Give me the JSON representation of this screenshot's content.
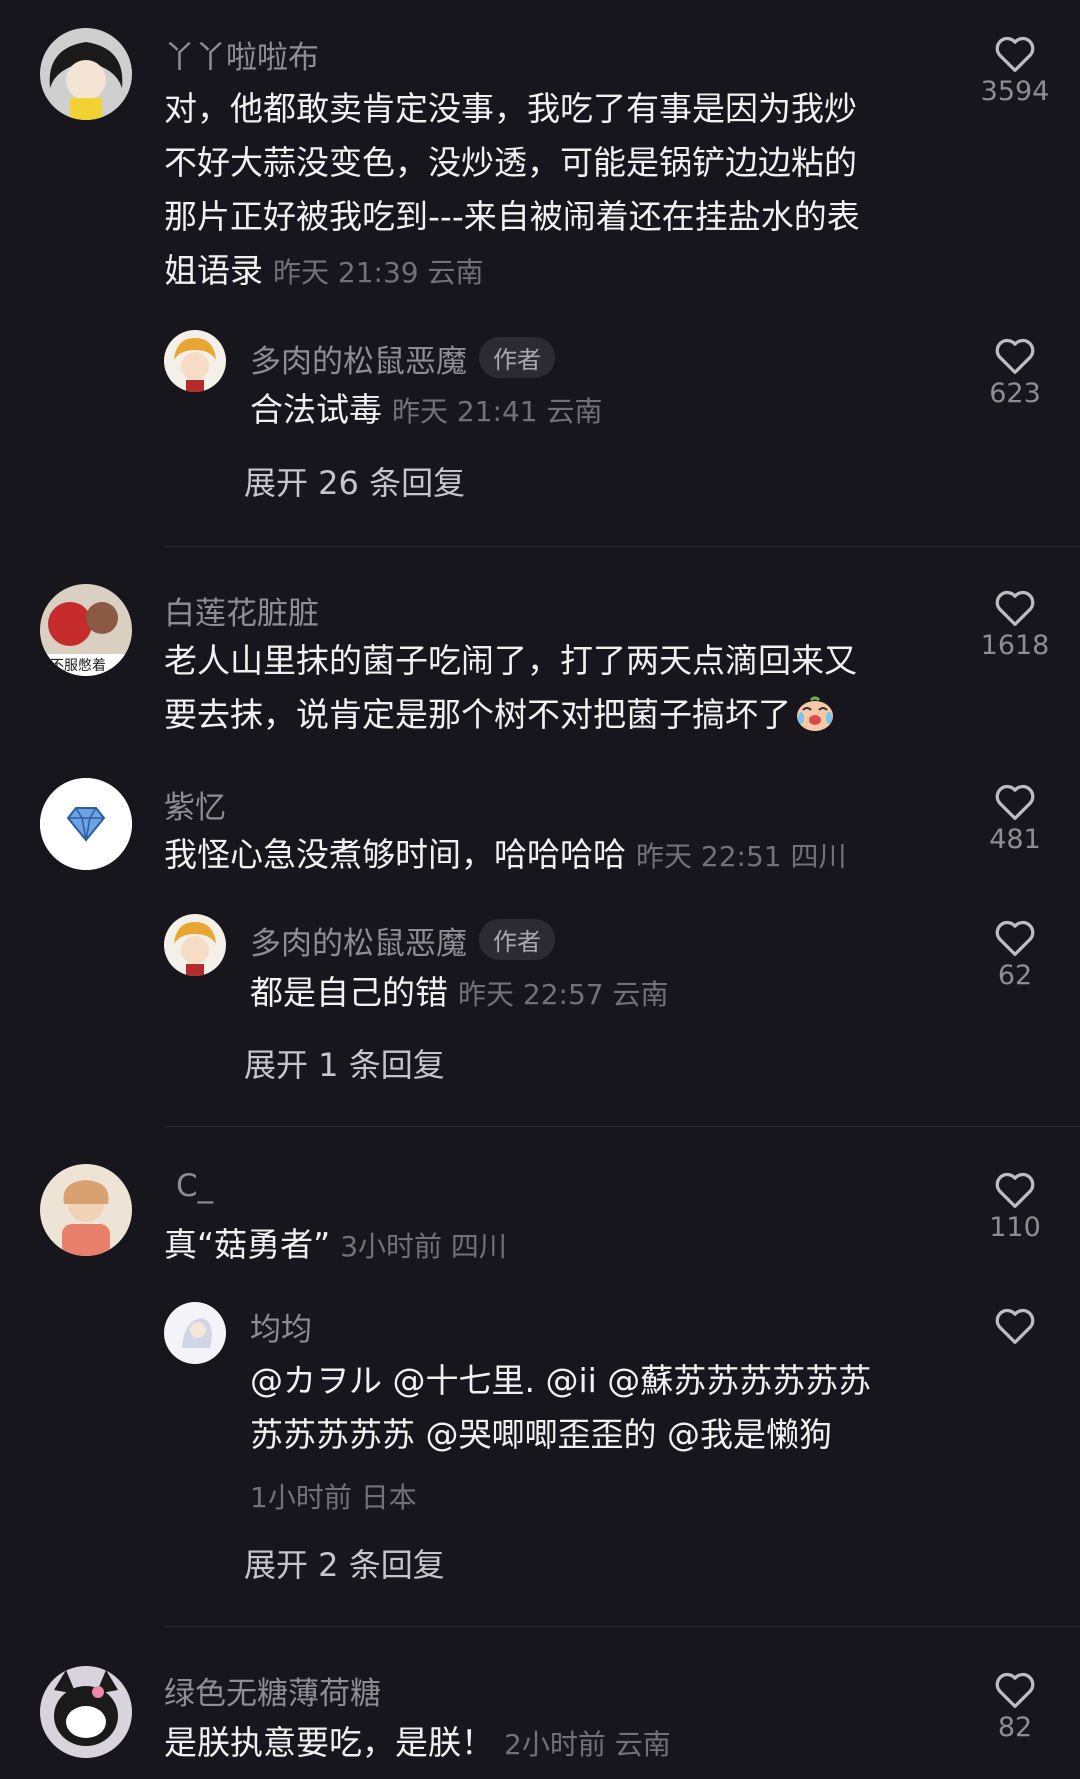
{
  "colors": {
    "background": "#17161c",
    "username": "#8e8d93",
    "text": "#f1f1f1",
    "meta": "#727176",
    "expand": "#c6c5ca"
  },
  "icons": {
    "like": "heart-outline-icon"
  },
  "comments": [
    {
      "username": "丫丫啦啦布",
      "lines": [
        "对，他都敢卖肯定没事，我吃了有事是因为我炒",
        "不好大蒜没变色，没炒透，可能是锅铲边边粘的",
        "那片正好被我吃到---来自被闹着还在挂盐水的表",
        "姐语录"
      ],
      "time": "昨天 21:39 云南",
      "likes": "3594",
      "reply": {
        "username": "多肉的松鼠恶魔",
        "badge": "作者",
        "text": "合法试毒",
        "time": "昨天 21:41 云南",
        "likes": "623"
      },
      "expand": "展开 26 条回复"
    },
    {
      "username": "白莲花脏脏",
      "lines": [
        "老人山里抹的菌子吃闹了，打了两天点滴回来又",
        "要去抹，说肯定是那个树不对把菌子搞坏了"
      ],
      "likes": "1618"
    },
    {
      "username": "紫忆",
      "lines": [
        "我怪心急没煮够时间，哈哈哈哈"
      ],
      "time": "昨天 22:51 四川",
      "likes": "481",
      "reply": {
        "username": "多肉的松鼠恶魔",
        "badge": "作者",
        "text": "都是自己的错",
        "time": "昨天 22:57 云南",
        "likes": "62"
      },
      "expand": "展开 1 条回复"
    },
    {
      "username": "C_",
      "lines": [
        "真“菇勇者”"
      ],
      "time": "3小时前 四川",
      "likes": "110",
      "reply": {
        "username": "均均",
        "lines": [
          "@カヲル @十七里. @ii @蘇苏苏苏苏苏苏",
          "苏苏苏苏苏 @哭唧唧歪歪的 @我是懒狗"
        ],
        "time": "1小时前 日本",
        "likes": ""
      },
      "expand": "展开 2 条回复"
    },
    {
      "username": "绿色无糖薄荷糖",
      "lines": [
        "是朕执意要吃，是朕！"
      ],
      "time": "2小时前 云南",
      "likes": "82"
    }
  ]
}
